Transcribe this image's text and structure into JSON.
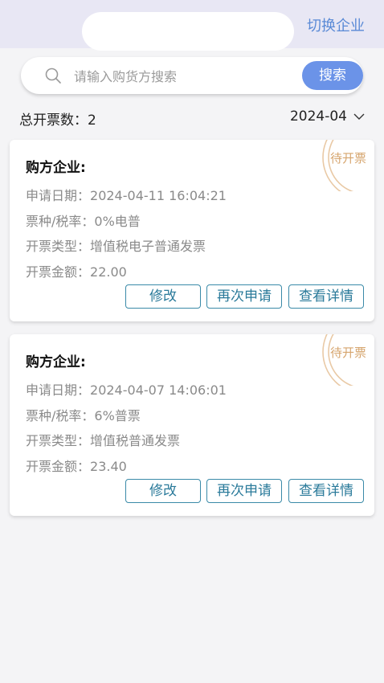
{
  "header": {
    "switch_label": "切换企业"
  },
  "search": {
    "placeholder": "请输入购货方搜索",
    "button_label": "搜索"
  },
  "summary": {
    "label": "总开票数：",
    "count": "2",
    "month": "2024-04"
  },
  "cards": [
    {
      "title": "购方企业:",
      "status": "待开票",
      "date_label": "申请日期：",
      "date": "2024-04-11 16:04:21",
      "kind_label": "票种/税率：",
      "kind": "0%电普",
      "type_label": "开票类型：",
      "type": "增值税电子普通发票",
      "amount_label": "开票金额：",
      "amount": "22.00",
      "btn_modify": "修改",
      "btn_reapply": "再次申请",
      "btn_detail": "查看详情"
    },
    {
      "title": "购方企业:",
      "status": "待开票",
      "date_label": "申请日期：",
      "date": "2024-04-07 14:06:01",
      "kind_label": "票种/税率：",
      "kind": "6%普票",
      "type_label": "开票类型：",
      "type": "增值税普通发票",
      "amount_label": "开票金额：",
      "amount": "23.40",
      "btn_modify": "修改",
      "btn_reapply": "再次申请",
      "btn_detail": "查看详情"
    }
  ],
  "colors": {
    "accent": "#6b93e8",
    "link": "#5a8ad6",
    "button_border": "#3a8aa8",
    "stamp": "#d6a56e"
  }
}
